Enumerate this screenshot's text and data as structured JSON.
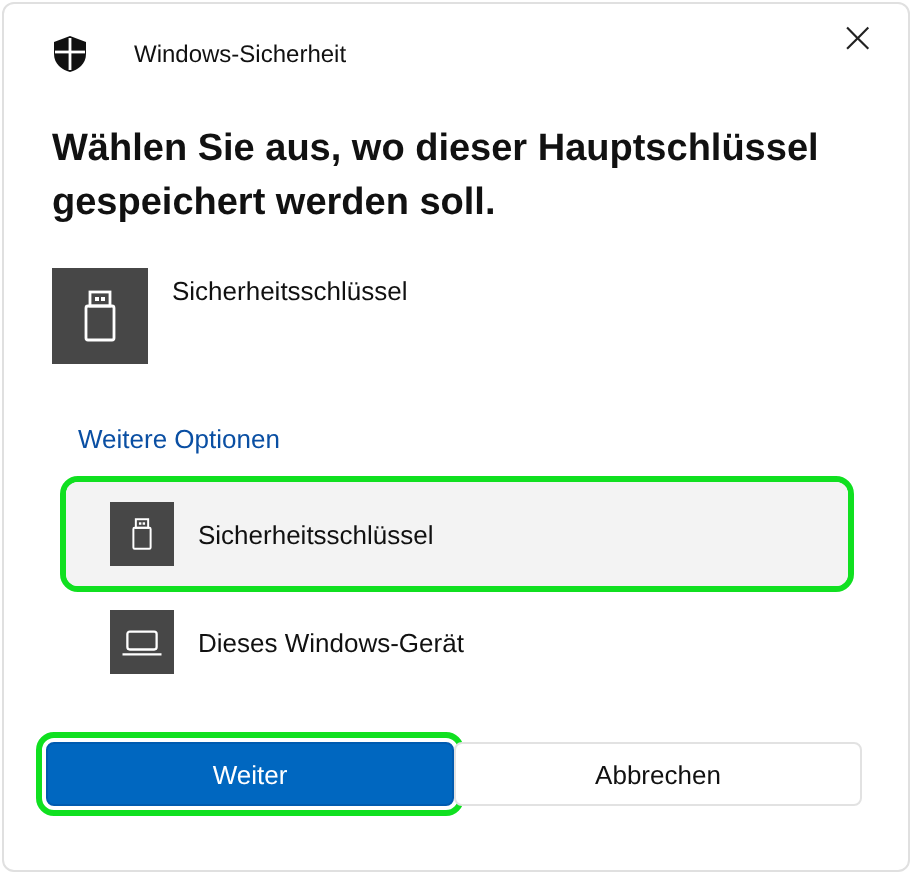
{
  "window": {
    "title": "Windows-Sicherheit",
    "close": "×"
  },
  "heading": "Wählen Sie aus, wo dieser Hauptschlüssel gespeichert werden soll.",
  "current": {
    "kind": "usb",
    "label": "Sicherheitsschlüssel"
  },
  "more_options_link": "Weitere Optionen",
  "options": [
    {
      "kind": "usb",
      "label": "Sicherheitsschlüssel",
      "selected": true,
      "highlighted": true
    },
    {
      "kind": "laptop",
      "label": "Dieses Windows-Gerät",
      "selected": false,
      "highlighted": false
    }
  ],
  "buttons": [
    {
      "kind": "primary",
      "label": "Weiter",
      "highlighted": true
    },
    {
      "kind": "secondary",
      "label": "Abbrechen",
      "highlighted": false
    }
  ]
}
